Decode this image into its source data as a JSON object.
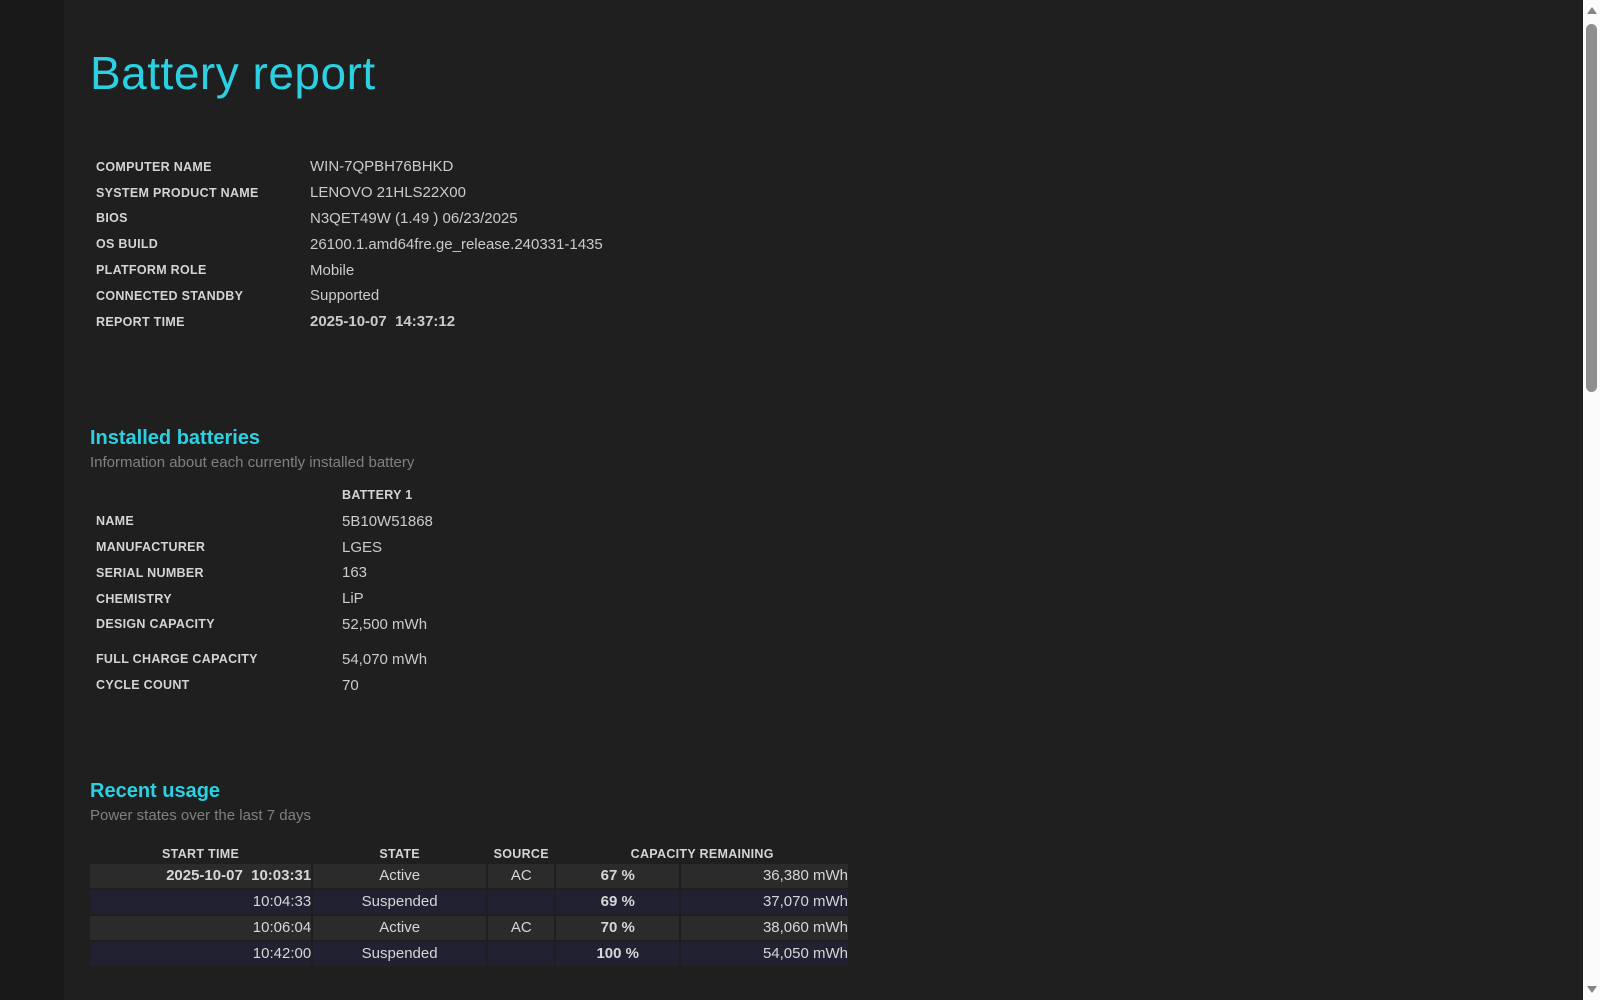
{
  "title": "Battery report",
  "accent_color": "#2bd1e3",
  "background_color": "#1f1f1f",
  "system_info": {
    "rows": [
      {
        "label": "COMPUTER NAME",
        "value": "WIN-7QPBH76BHKD"
      },
      {
        "label": "SYSTEM PRODUCT NAME",
        "value": "LENOVO 21HLS22X00"
      },
      {
        "label": "BIOS",
        "value": "N3QET49W (1.49 ) 06/23/2025"
      },
      {
        "label": "OS BUILD",
        "value": "26100.1.amd64fre.ge_release.240331-1435"
      },
      {
        "label": "PLATFORM ROLE",
        "value": "Mobile"
      },
      {
        "label": "CONNECTED STANDBY",
        "value": "Supported"
      },
      {
        "label": "REPORT TIME",
        "value": "2025-10-07  14:37:12",
        "value_bold": true
      }
    ]
  },
  "installed_batteries": {
    "heading": "Installed batteries",
    "subtitle": "Information about each currently installed battery",
    "column_header": "BATTERY 1",
    "rows": [
      {
        "label": "NAME",
        "value": "5B10W51868"
      },
      {
        "label": "MANUFACTURER",
        "value": "LGES"
      },
      {
        "label": "SERIAL NUMBER",
        "value": "163"
      },
      {
        "label": "CHEMISTRY",
        "value": "LiP"
      },
      {
        "label": "DESIGN CAPACITY",
        "value": "52,500 mWh"
      },
      {
        "label": "FULL CHARGE CAPACITY",
        "value": "54,070 mWh",
        "gap_before": true
      },
      {
        "label": "CYCLE COUNT",
        "value": "70"
      }
    ]
  },
  "recent_usage": {
    "heading": "Recent usage",
    "subtitle": "Power states over the last 7 days",
    "columns": [
      "START TIME",
      "STATE",
      "SOURCE",
      "CAPACITY REMAINING"
    ],
    "column_spans": [
      1,
      1,
      1,
      2
    ],
    "rows": [
      {
        "start_time": "2025-10-07  10:03:31",
        "state": "Active",
        "source": "AC",
        "percent": "67 %",
        "mwh": "36,380 mWh",
        "type": "active",
        "time_bold": true
      },
      {
        "start_time": "10:04:33",
        "state": "Suspended",
        "source": "",
        "percent": "69 %",
        "mwh": "37,070 mWh",
        "type": "suspended",
        "time_bold": false
      },
      {
        "start_time": "10:06:04",
        "state": "Active",
        "source": "AC",
        "percent": "70 %",
        "mwh": "38,060 mWh",
        "type": "active",
        "time_bold": false
      },
      {
        "start_time": "10:42:00",
        "state": "Suspended",
        "source": "",
        "percent": "100 %",
        "mwh": "54,050 mWh",
        "type": "suspended",
        "time_bold": false
      }
    ],
    "row_colors": {
      "active": "#2b2b2b",
      "suspended": "#212132"
    }
  },
  "scrollbar": {
    "track_color": "#fbfbfb",
    "thumb_color": "#8f8f8f"
  }
}
